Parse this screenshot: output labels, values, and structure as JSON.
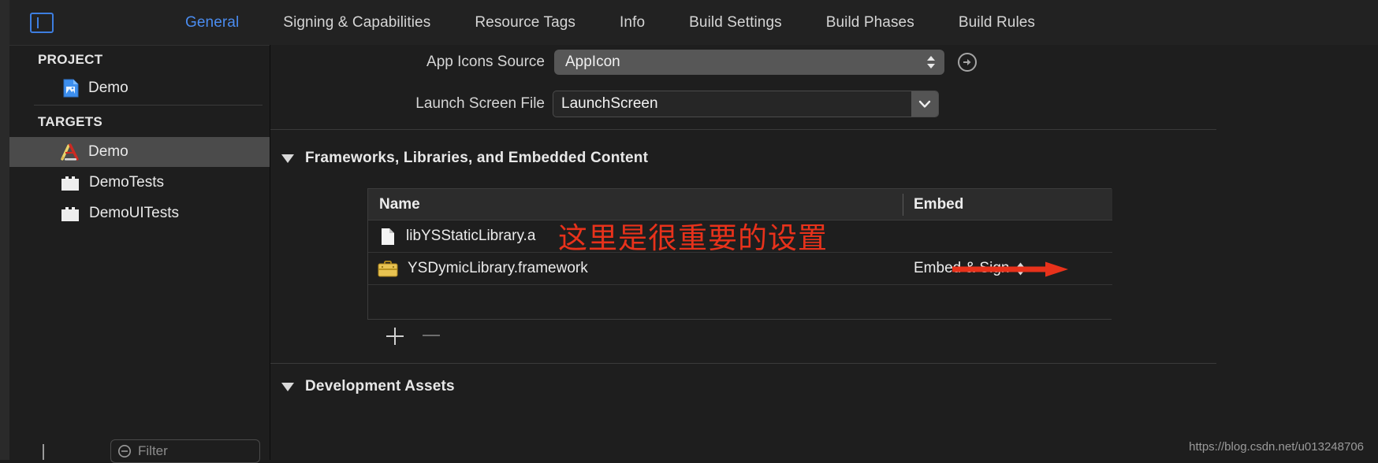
{
  "window": {
    "nav_toggle_icon": "sidebar-toggle-icon"
  },
  "tabs": [
    {
      "label": "General",
      "active": true
    },
    {
      "label": "Signing & Capabilities",
      "active": false
    },
    {
      "label": "Resource Tags",
      "active": false
    },
    {
      "label": "Info",
      "active": false
    },
    {
      "label": "Build Settings",
      "active": false
    },
    {
      "label": "Build Phases",
      "active": false
    },
    {
      "label": "Build Rules",
      "active": false
    }
  ],
  "sidebar": {
    "project_group_label": "PROJECT",
    "targets_group_label": "TARGETS",
    "project_items": [
      {
        "label": "Demo",
        "icon": "xcode-project-icon"
      }
    ],
    "target_items": [
      {
        "label": "Demo",
        "icon": "app-target-icon",
        "selected": true
      },
      {
        "label": "DemoTests",
        "icon": "test-bundle-icon",
        "selected": false
      },
      {
        "label": "DemoUITests",
        "icon": "test-bundle-icon",
        "selected": false
      }
    ],
    "filter": {
      "placeholder": "Filter",
      "value": "Filter",
      "icon": "filter-icon"
    }
  },
  "main": {
    "app_icons_source": {
      "label": "App Icons Source",
      "value": "AppIcon",
      "stepper_icon": "stepper-up-down-icon",
      "reveal_icon": "arrow-right-circle-icon"
    },
    "launch_screen_file": {
      "label": "Launch Screen File",
      "value": "LaunchScreen",
      "chevron_icon": "chevron-down-icon"
    },
    "frameworks_section": {
      "title": "Frameworks, Libraries, and Embedded Content",
      "disclosure_icon": "disclosure-triangle-open-icon",
      "columns": [
        "Name",
        "Embed"
      ],
      "rows": [
        {
          "name": "libYSStaticLibrary.a",
          "icon": "static-library-file-icon",
          "embed": "",
          "embed_stepper": false
        },
        {
          "name": "YSDymicLibrary.framework",
          "icon": "framework-briefcase-icon",
          "embed": "Embed & Sign",
          "embed_stepper": true
        }
      ],
      "add_button_icon": "plus-icon",
      "remove_button_icon": "minus-icon"
    },
    "development_assets_section": {
      "title": "Development Assets",
      "disclosure_icon": "disclosure-triangle-open-icon"
    }
  },
  "annotation": {
    "text": "这里是很重要的设置",
    "color": "#e8321b",
    "arrow_icon": "red-arrow-right-icon"
  },
  "watermark": {
    "text": "https://blog.csdn.net/u013248706"
  },
  "colors": {
    "accent_blue": "#4a8cf0",
    "annotation_red": "#e8321b",
    "selected_row": "#4b4b4b",
    "background": "#1e1e1e"
  }
}
